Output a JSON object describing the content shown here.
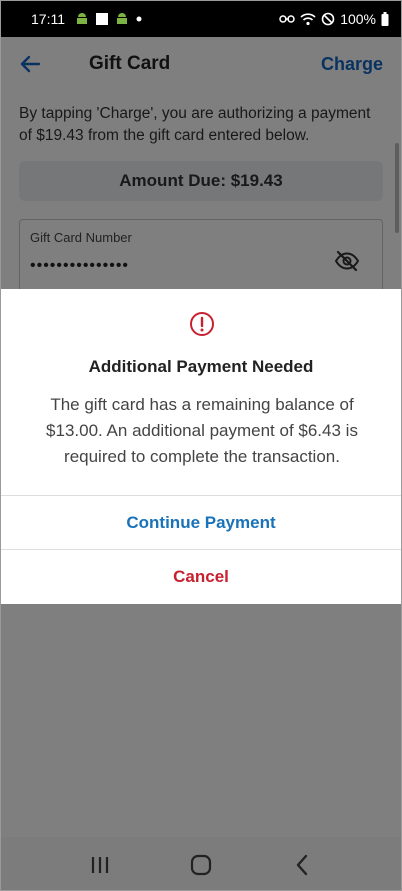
{
  "status_bar": {
    "time": "17:11",
    "battery": "100%",
    "left_icons": [
      "android-icon",
      "square-notification-icon",
      "android-icon",
      "dot-icon"
    ],
    "right_icons": [
      "link-icon",
      "wifi-icon",
      "do-not-disturb-icon",
      "battery-icon"
    ]
  },
  "app_bar": {
    "title": "Gift Card",
    "action_label": "Charge"
  },
  "page": {
    "auth_text": "By tapping 'Charge', you are authorizing a payment of $19.43 from the gift card entered below.",
    "amount_due": "Amount Due: $19.43",
    "card_field": {
      "label": "Gift Card Number",
      "value": "•••••••••••••••"
    }
  },
  "dialog": {
    "title": "Additional Payment Needed",
    "message": "The gift card has a remaining balance of $13.00. An additional payment of $6.43 is required to complete the transaction.",
    "continue_label": "Continue Payment",
    "cancel_label": "Cancel"
  },
  "colors": {
    "accent": "#1565c0",
    "danger": "#c8202f",
    "scrim": "rgba(0,0,0,0.5)"
  }
}
